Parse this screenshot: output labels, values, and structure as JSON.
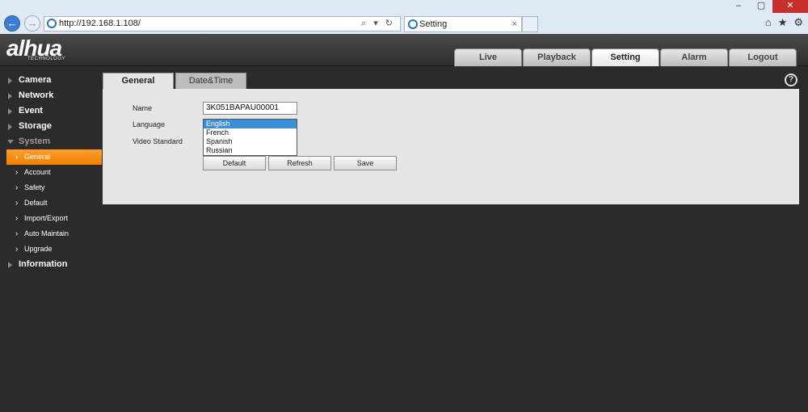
{
  "browser": {
    "url": "http://192.168.1.108/",
    "tab_title": "Setting",
    "tab_close": "×",
    "addr_tools": "⌕ ▾ ↻",
    "win": {
      "min": "–",
      "max": "▢",
      "close": "✕"
    },
    "nav_back": "←",
    "nav_forward": "→",
    "right_icons": {
      "home": "⌂",
      "star": "★",
      "gear": "⚙"
    }
  },
  "app": {
    "logo": "alhua",
    "logo_sub": "TECHNOLOGY"
  },
  "topnav": {
    "live": "Live",
    "playback": "Playback",
    "setting": "Setting",
    "alarm": "Alarm",
    "logout": "Logout"
  },
  "sidebar": {
    "camera": "Camera",
    "network": "Network",
    "event": "Event",
    "storage": "Storage",
    "system": "System",
    "sub": {
      "general": "General",
      "account": "Account",
      "safety": "Safety",
      "default": "Default",
      "import_export": "Import/Export",
      "auto_maintain": "Auto Maintain",
      "upgrade": "Upgrade"
    },
    "information": "Information",
    "chevron": "›"
  },
  "content": {
    "tabs": {
      "general": "General",
      "datetime": "Date&Time"
    },
    "help": "?",
    "fields": {
      "name_label": "Name",
      "name_value": "3K051BAPAU00001",
      "language_label": "Language",
      "video_standard_label": "Video Standard"
    },
    "language_options": [
      "English",
      "French",
      "Spanish",
      "Russian"
    ],
    "buttons": {
      "default": "Default",
      "refresh": "Refresh",
      "save": "Save"
    }
  },
  "colors": {
    "accent_orange": "#f08000",
    "selection_blue": "#3b8fd9",
    "close_red": "#c7302a"
  }
}
